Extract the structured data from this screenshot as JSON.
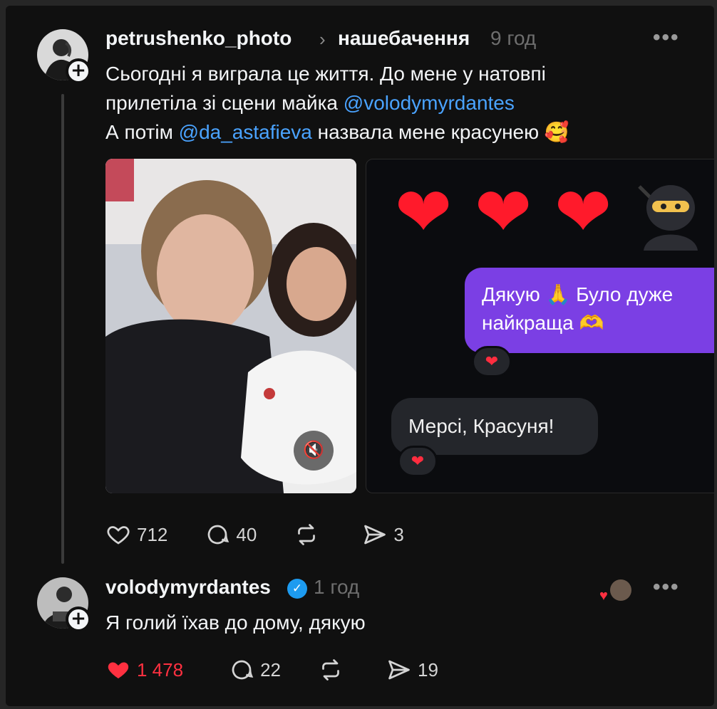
{
  "post1": {
    "username": "petrushenko_photo",
    "topic": "нашебачення",
    "time": "9 год",
    "text_line1": "Сьогодні я виграла це життя. До мене у натовпі",
    "text_line2_pre": "прилетіла зі сцени майка ",
    "mention1": "@volodymyrdantes",
    "text_line3_pre": "А потім ",
    "mention2": "@da_astafieva",
    "text_line3_post": " назвала мене красунею",
    "emoji_end": "🥰",
    "screenshot": {
      "top_emojis": [
        "❤",
        "❤",
        "❤"
      ],
      "message_sent_line1": "Дякую 🙏 Було дуже",
      "message_sent_line2": "найкраща 🫶",
      "message_received": "Мерсі, Красуня!",
      "reaction": "❤"
    },
    "actions": {
      "likes": "712",
      "comments": "40",
      "shares": "3"
    }
  },
  "post2": {
    "username": "volodymyrdantes",
    "time": "1 год",
    "text": "Я голий їхав до дому, дякую",
    "actions": {
      "likes": "1 478",
      "comments": "22",
      "shares": "19"
    }
  },
  "colors": {
    "background": "#101010",
    "mention": "#4aa3ff",
    "liked": "#ff3040",
    "bubble": "#7b3fe4",
    "verified": "#1d9bf0"
  }
}
